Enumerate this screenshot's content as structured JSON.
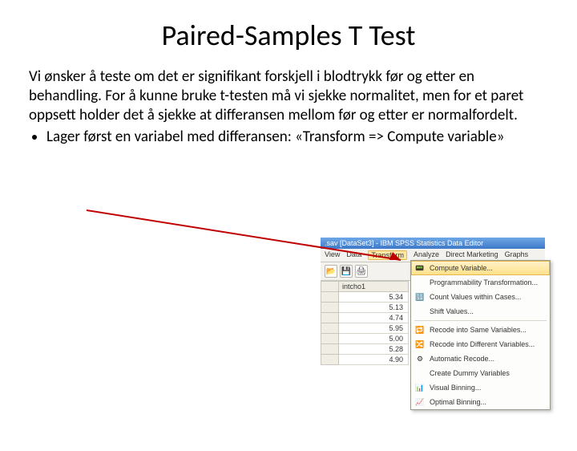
{
  "title": "Paired-Samples T Test",
  "paragraph": "Vi ønsker å teste om det er signifikant forskjell i blodtrykk før og etter en behandling. For å kunne bruke t-testen må vi sjekke normalitet, men for et paret oppsett holder det å sjekke at differansen mellom før og etter er normalfordelt.",
  "bullet": "Lager først en variabel med differansen: «Transform => Compute variable»",
  "spss": {
    "title": ".sav [DataSet3] - IBM SPSS Statistics Data Editor",
    "menus": {
      "view": "View",
      "data": "Data",
      "transform": "Transform",
      "analyze": "Analyze",
      "direct": "Direct Marketing",
      "graphs": "Graphs"
    },
    "dropdown": {
      "compute": "Compute Variable...",
      "progtrans": "Programmability Transformation...",
      "count": "Count Values within Cases...",
      "shift": "Shift Values...",
      "recodesame": "Recode into Same Variables...",
      "recodediff": "Recode into Different Variables...",
      "autorecode": "Automatic Recode...",
      "createdummy": "Create Dummy Variables",
      "visualbin": "Visual Binning...",
      "optimalbin": "Optimal Binning..."
    },
    "colhdr": "intcho1",
    "rows": [
      "5.34",
      "5.13",
      "4.74",
      "5.95",
      "5.00",
      "5.28",
      "4.90"
    ]
  }
}
